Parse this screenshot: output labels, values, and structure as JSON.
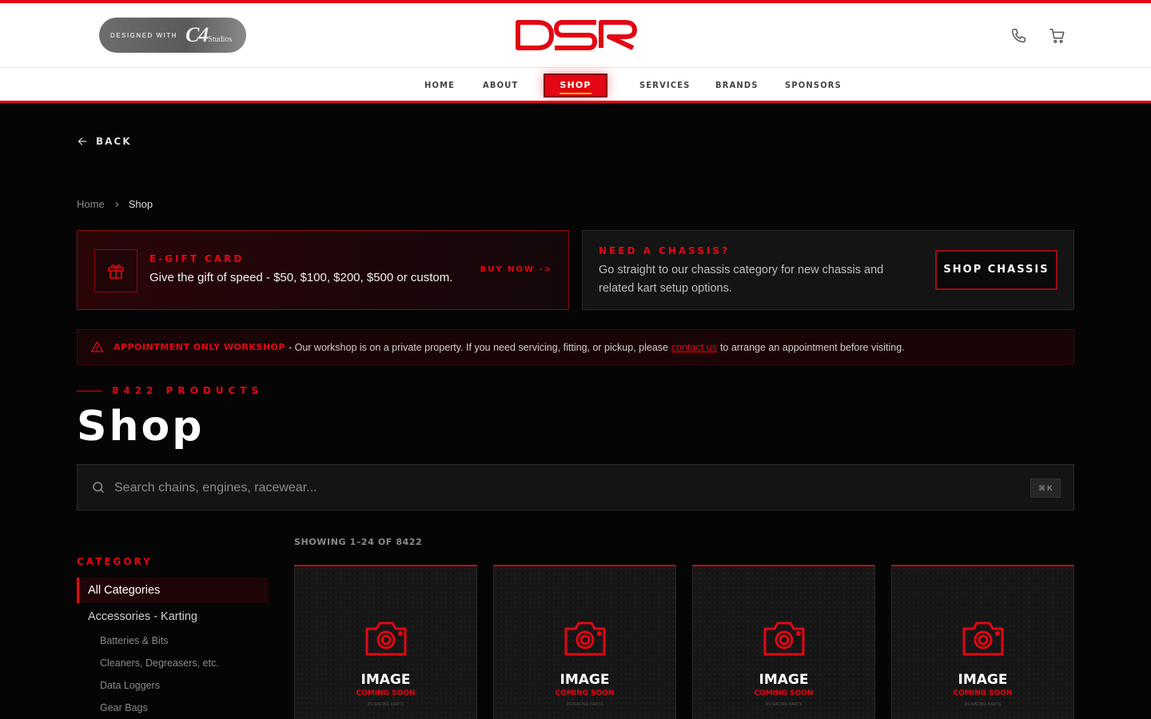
{
  "header": {
    "badge_small": "DESIGNED WITH",
    "badge_logo": "C4",
    "badge_logo_sub": "Studios",
    "logo": "DSR"
  },
  "nav": {
    "items": [
      "HOME",
      "ABOUT",
      "SHOP",
      "SERVICES",
      "BRANDS",
      "SPONSORS"
    ],
    "active": "SHOP"
  },
  "back_label": "BACK",
  "breadcrumb": [
    "Home",
    "Shop"
  ],
  "gift_card": {
    "title": "E-GIFT CARD",
    "description": "Give the gift of speed - $50, $100, $200, $500 or custom.",
    "cta": "BUY NOW ->"
  },
  "chassis": {
    "title": "NEED A CHASSIS?",
    "description": "Go straight to our chassis category for new chassis and related kart setup options.",
    "cta": "SHOP CHASSIS"
  },
  "notice": {
    "title": "APPOINTMENT ONLY WORKSHOP",
    "text_before": "- Our workshop is on a private property. If you need servicing, fitting, or pickup, please",
    "link": "contact us",
    "text_after": "to arrange an appointment before visiting."
  },
  "product_count": "8422 PRODUCTS",
  "page_title": "Shop",
  "search": {
    "placeholder": "Search chains, engines, racewear...",
    "shortcut": "⌘ K"
  },
  "sidebar": {
    "title": "CATEGORY",
    "selected": "All Categories",
    "main": "Accessories - Karting",
    "subs": [
      "Batteries & Bits",
      "Cleaners, Degreasers, etc.",
      "Data Loggers",
      "Gear Bags"
    ]
  },
  "results": {
    "showing": "SHOWING 1–24 OF 8422",
    "placeholder_title": "IMAGE",
    "placeholder_sub": "COMING SOON",
    "placeholder_brand": "DS RACING KARTS"
  },
  "colors": {
    "accent": "#e30613",
    "background": "#050505"
  },
  "icons": [
    "arrow-left-icon",
    "chevron-right-icon",
    "gift-icon",
    "warning-icon",
    "search-icon",
    "phone-icon",
    "cart-icon",
    "camera-icon"
  ]
}
